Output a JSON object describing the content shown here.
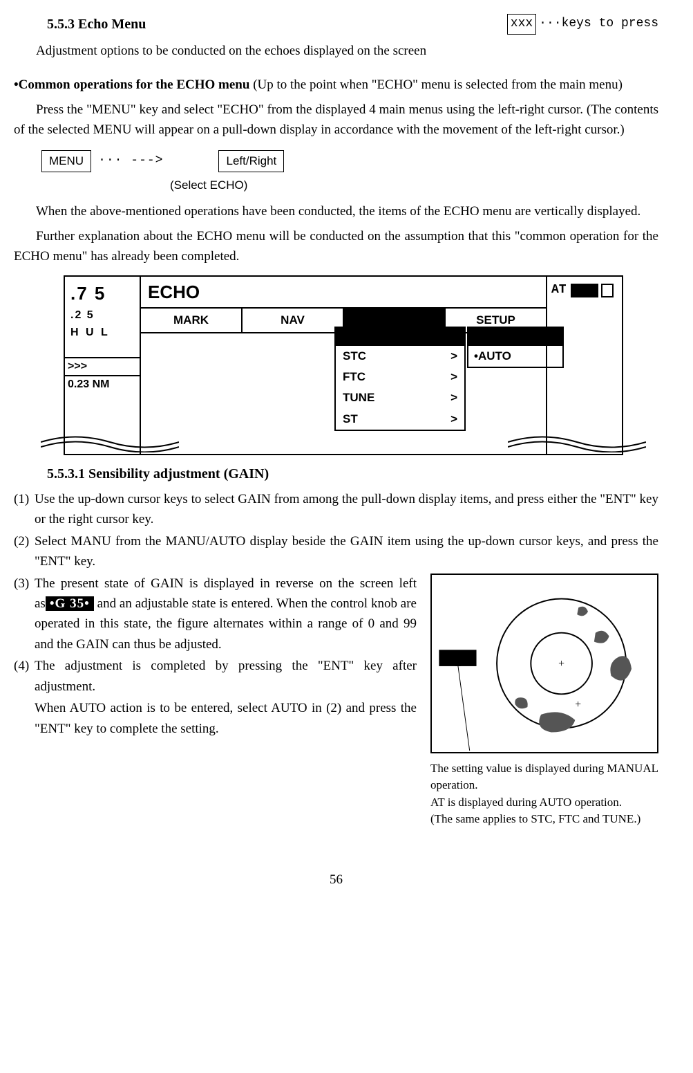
{
  "section": {
    "num_title": "5.5.3 Echo Menu"
  },
  "legend": {
    "xxx": "xxx",
    "keys_to_press": "···keys to press"
  },
  "intro": "Adjustment options to be conducted on the echoes displayed on the screen",
  "common": {
    "lead": "•Common operations for the ECHO menu",
    "lead_rest": "  (Up to the point when \"ECHO\" menu is selected from the main menu)",
    "p1": "Press the \"MENU\" key and select \"ECHO\" from the displayed 4 main menus using the left-right cursor.  (The contents of the selected MENU will appear on a pull-down display in accordance with the movement of the left-right cursor.)",
    "key_menu": "MENU",
    "dots_arrow": "··· --->",
    "key_lr": "Left/Right",
    "select_echo": "(Select ECHO)",
    "p2": "When the above-mentioned operations have been conducted, the items of the ECHO menu are vertically displayed.",
    "p3": "Further explanation about the ECHO menu will be conducted on the assumption that this \"common operation for the ECHO menu\" has already been completed."
  },
  "diagram": {
    "range_big": ".7 5",
    "range_small": ".2 5",
    "hul": "H U   L",
    "arrows": ">>>",
    "dist": "0.23 NM",
    "title": "ECHO",
    "tabs": [
      "MARK",
      "NAV",
      "",
      "SETUP"
    ],
    "drop_items": [
      {
        "label": "STC",
        "suffix": ">"
      },
      {
        "label": "FTC",
        "suffix": ">"
      },
      {
        "label": "TUNE",
        "suffix": ">"
      },
      {
        "label": "ST",
        "suffix": ">"
      }
    ],
    "side_auto": "•AUTO",
    "at": "AT"
  },
  "gain": {
    "title": "5.5.3.1 Sensibility adjustment (GAIN)",
    "i1": "Use the up-down cursor keys to select GAIN from among the pull-down display items, and press either the \"ENT\" key or the right cursor key.",
    "i2": "Select MANU from the MANU/AUTO display beside the GAIN item using the up-down cursor keys, and press the \"ENT\" key.",
    "i3a": "The present state of GAIN is displayed in reverse on the screen left as",
    "i3_g35": "•G 35•",
    "i3b": " and an adjustable state is entered. When the control knob are operated in this state, the figure alternates within a range of 0 and 99 and the GAIN can thus be adjusted.",
    "i4": "The adjustment is completed by pressing the \"ENT\" key after adjustment.",
    "p_auto": "When  AUTO action is to be entered, select AUTO in (2) and press the \"ENT\" key to complete the setting."
  },
  "fig_caption": {
    "l1": "The setting value is displayed during MANUAL operation.",
    "l2": "AT is displayed during AUTO operation.",
    "l3": "(The same applies to STC, FTC and TUNE.)"
  },
  "page": "56"
}
